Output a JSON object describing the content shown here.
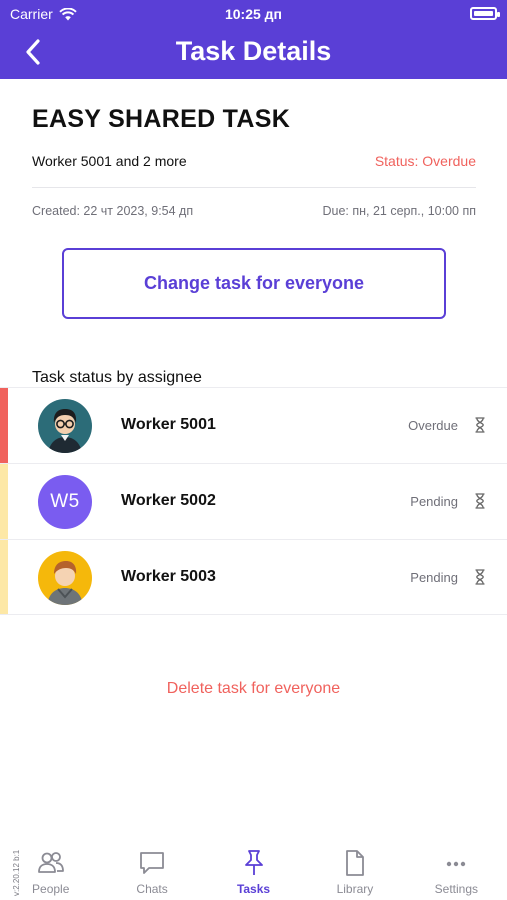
{
  "status_bar": {
    "carrier": "Carrier",
    "time": "10:25 дп",
    "battery_level": 1.0
  },
  "header": {
    "title": "Task Details",
    "accent_color": "#5a3fd6"
  },
  "task": {
    "name": "EASY SHARED TASK",
    "assignees_summary": "Worker 5001 and 2 more",
    "status_text": "Status: Overdue",
    "created": "Created: 22 чт 2023, 9:54 дп",
    "due": "Due: пн, 21 серп., 10:00 пп"
  },
  "actions": {
    "change_label": "Change task for everyone",
    "delete_label": "Delete task for everyone"
  },
  "assignees": {
    "heading": "Task status by assignee",
    "items": [
      {
        "name": "Worker 5001",
        "status": "Overdue",
        "status_color": "#f0625d",
        "avatar": "glasses-man-avatar"
      },
      {
        "name": "Worker 5002",
        "status": "Pending",
        "status_color": "#fde8a6",
        "avatar_initials": "W5"
      },
      {
        "name": "Worker 5003",
        "status": "Pending",
        "status_color": "#fde8a6",
        "avatar": "hoodie-man-avatar"
      }
    ]
  },
  "tabs": [
    {
      "label": "People",
      "icon": "people-icon"
    },
    {
      "label": "Chats",
      "icon": "chat-bubble-icon"
    },
    {
      "label": "Tasks",
      "icon": "pin-icon",
      "active": true
    },
    {
      "label": "Library",
      "icon": "document-icon"
    },
    {
      "label": "Settings",
      "icon": "more-dots-icon"
    }
  ],
  "version": "v:2.20.12 b:1"
}
